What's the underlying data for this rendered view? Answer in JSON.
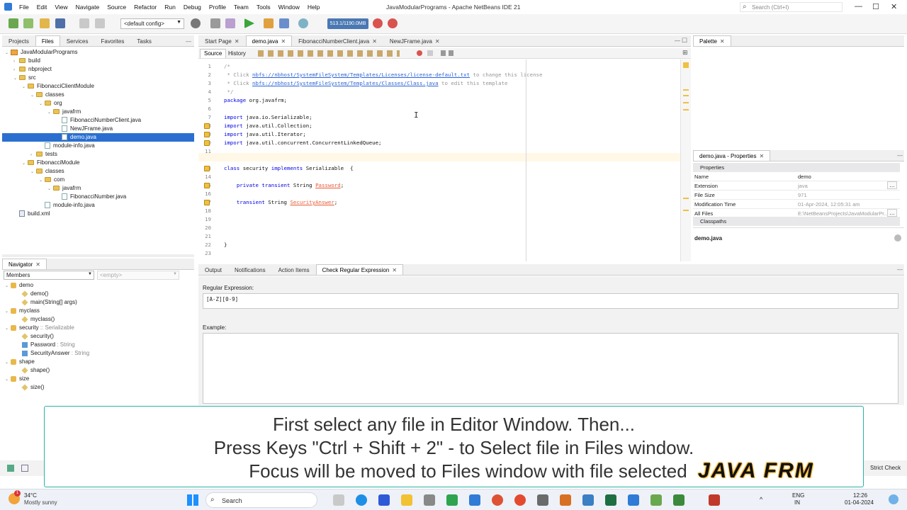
{
  "app": {
    "title": "JavaModularPrograms - Apache NetBeans IDE 21",
    "menu": [
      "File",
      "Edit",
      "View",
      "Navigate",
      "Source",
      "Refactor",
      "Run",
      "Debug",
      "Profile",
      "Team",
      "Tools",
      "Window",
      "Help"
    ],
    "search_placeholder": "Search (Ctrl+I)"
  },
  "toolbar": {
    "config": "<default config>",
    "memory": "513.1/1190.0MB"
  },
  "files_panel": {
    "tabs": [
      "Projects",
      "Files",
      "Services",
      "Favorites",
      "Tasks"
    ],
    "active_tab": "Files",
    "tree": [
      {
        "label": "JavaModularPrograms",
        "type": "project",
        "depth": 0,
        "expanded": true
      },
      {
        "label": "build",
        "type": "folder",
        "depth": 1,
        "expanded": false
      },
      {
        "label": "nbproject",
        "type": "folder",
        "depth": 1,
        "expanded": false
      },
      {
        "label": "src",
        "type": "folder",
        "depth": 1,
        "expanded": true
      },
      {
        "label": "FibonacciClientModule",
        "type": "folder",
        "depth": 2,
        "expanded": true
      },
      {
        "label": "classes",
        "type": "folder",
        "depth": 3,
        "expanded": true
      },
      {
        "label": "org",
        "type": "folder",
        "depth": 4,
        "expanded": true
      },
      {
        "label": "javafrm",
        "type": "folder",
        "depth": 5,
        "expanded": true
      },
      {
        "label": "FibonacciNumberClient.java",
        "type": "java",
        "depth": 6
      },
      {
        "label": "NewJFrame.java",
        "type": "java",
        "depth": 6
      },
      {
        "label": "demo.java",
        "type": "java",
        "depth": 6,
        "selected": true
      },
      {
        "label": "module-info.java",
        "type": "java",
        "depth": 4
      },
      {
        "label": "tests",
        "type": "folder",
        "depth": 3,
        "expanded": false
      },
      {
        "label": "FibonacciModule",
        "type": "folder",
        "depth": 2,
        "expanded": true
      },
      {
        "label": "classes",
        "type": "folder",
        "depth": 3,
        "expanded": true
      },
      {
        "label": "com",
        "type": "folder",
        "depth": 4,
        "expanded": true
      },
      {
        "label": "javafrm",
        "type": "folder",
        "depth": 5,
        "expanded": true
      },
      {
        "label": "FibonacciNumber.java",
        "type": "java",
        "depth": 6
      },
      {
        "label": "module-info.java",
        "type": "java",
        "depth": 4
      },
      {
        "label": "build.xml",
        "type": "xml",
        "depth": 1
      }
    ]
  },
  "navigator": {
    "title": "Navigator",
    "filter": "Members",
    "filter2": "<empty>",
    "items": [
      {
        "label": "demo",
        "depth": 0
      },
      {
        "label": "demo()",
        "depth": 1
      },
      {
        "label": "main(String[] args)",
        "depth": 1
      },
      {
        "label": "myclass",
        "depth": 0
      },
      {
        "label": "myclass()",
        "depth": 1
      },
      {
        "label": "security",
        "suffix": " :: Serializable",
        "depth": 0
      },
      {
        "label": "security()",
        "depth": 1
      },
      {
        "label": "Password",
        "suffix": " : String",
        "depth": 1
      },
      {
        "label": "SecurityAnswer",
        "suffix": " : String",
        "depth": 1
      },
      {
        "label": "shape",
        "depth": 0
      },
      {
        "label": "shape()",
        "depth": 1
      },
      {
        "label": "size",
        "depth": 0
      },
      {
        "label": "size()",
        "depth": 1
      }
    ]
  },
  "editor": {
    "tabs": [
      "Start Page",
      "demo.java",
      "FibonacciNumberClient.java",
      "NewJFrame.java"
    ],
    "active_tab": "demo.java",
    "views": [
      "Source",
      "History"
    ],
    "lines": [
      {
        "n": "1",
        "text": "/*",
        "cls": "cm"
      },
      {
        "n": "2",
        "pre": " * Click ",
        "link": "nbfs://nbhost/SystemFileSystem/Templates/Licenses/license-default.txt",
        "post": " to change this license",
        "cls": "cm"
      },
      {
        "n": "3",
        "pre": " * Click ",
        "link": "nbfs://nbhost/SystemFileSystem/Templates/Classes/Class.java",
        "post": " to edit this template",
        "cls": "cm"
      },
      {
        "n": "4",
        "text": " */",
        "cls": "cm"
      },
      {
        "n": "5",
        "kw": "package",
        "text": " org.javafrm;"
      },
      {
        "n": "6",
        "text": ""
      },
      {
        "n": "7",
        "kw": "import",
        "text": " java.io.Serializable;"
      },
      {
        "n": "8",
        "kw": "import",
        "text": " java.util.Collection;",
        "hint": true
      },
      {
        "n": "9",
        "kw": "import",
        "text": " java.util.Iterator;",
        "hint": true
      },
      {
        "n": "10",
        "kw": "import",
        "text": " java.util.concurrent.ConcurrentLinkedQueue;",
        "hint": true
      },
      {
        "n": "11",
        "text": ""
      },
      {
        "n": "12",
        "text": ""
      },
      {
        "n": "13",
        "kw": "class",
        "text": " security ",
        "kw2": "implements",
        "post": " Serializable  {",
        "hint": true
      },
      {
        "n": "14",
        "text": ""
      },
      {
        "n": "15",
        "indent": "    ",
        "kw": "private transient",
        "text": " String ",
        "field": "Password",
        "post": ";",
        "hint": true
      },
      {
        "n": "16",
        "text": ""
      },
      {
        "n": "17",
        "indent": "    ",
        "kw": "transient",
        "text": " String ",
        "field": "SecurityAnswer",
        "post": ";",
        "hint": true
      },
      {
        "n": "18",
        "text": ""
      },
      {
        "n": "19",
        "text": ""
      },
      {
        "n": "20",
        "text": ""
      },
      {
        "n": "21",
        "text": ""
      },
      {
        "n": "22",
        "text": "}"
      },
      {
        "n": "23",
        "text": ""
      }
    ]
  },
  "palette": {
    "title": "Palette"
  },
  "properties": {
    "title": "demo.java - Properties",
    "section": "Properties",
    "rows": [
      {
        "k": "Name",
        "v": "demo"
      },
      {
        "k": "Extension",
        "v": "java"
      },
      {
        "k": "File Size",
        "v": "971"
      },
      {
        "k": "Modification Time",
        "v": "01-Apr-2024, 12:05:31 am"
      },
      {
        "k": "All Files",
        "v": "E:\\NetBeansProjects\\JavaModularPr..."
      }
    ],
    "section2": "Classpaths",
    "footer": "demo.java"
  },
  "output_panel": {
    "tabs": [
      "Output",
      "Notifications",
      "Action Items",
      "Check Regular Expression"
    ],
    "active_tab": "Check Regular Expression",
    "regex_label": "Regular Expression:",
    "regex_value": "[A-Z][0-9]",
    "example_label": "Example:",
    "strict_check": "Strict Check"
  },
  "caption": {
    "line1": "First select any file in Editor Window. Then...",
    "line2": "Press Keys \"Ctrl + Shift + 2\" - to Select file in Files window.",
    "line3": "Focus will be moved to Files window with file selected",
    "brand": "JAVA FRM"
  },
  "taskbar": {
    "weather_temp": "34°C",
    "weather_desc": "Mostly sunny",
    "search": "Search",
    "lang1": "ENG",
    "lang2": "IN",
    "time": "12:26",
    "date": "01-04-2024"
  }
}
